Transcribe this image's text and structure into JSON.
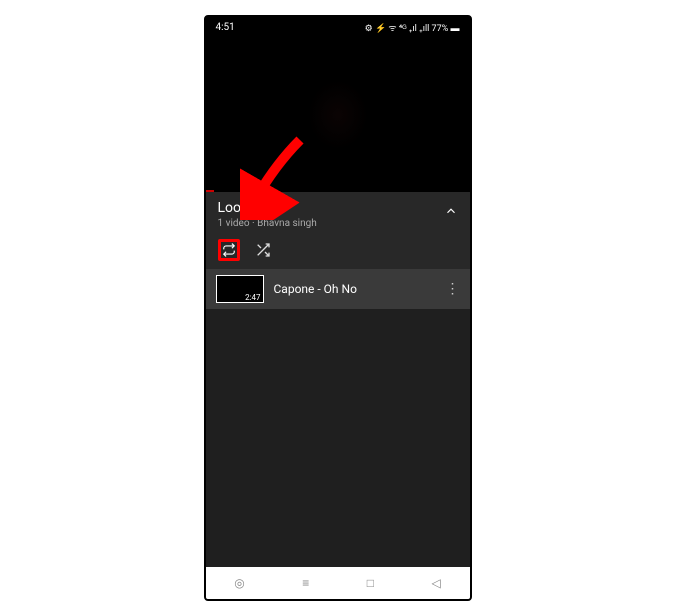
{
  "status": {
    "time": "4:51",
    "right": "⚙ ⚡ ᯤ ⁴ᴳ ₊ıl ₊ıll 77% ▬"
  },
  "playlist": {
    "title": "Loop",
    "subtitle": "1 video · Bhavna singh"
  },
  "track": {
    "duration": "2:47",
    "title": "Capone - Oh No"
  },
  "nav": {
    "recent": "◎",
    "menu": "≡",
    "home": "□",
    "back": "◁"
  }
}
